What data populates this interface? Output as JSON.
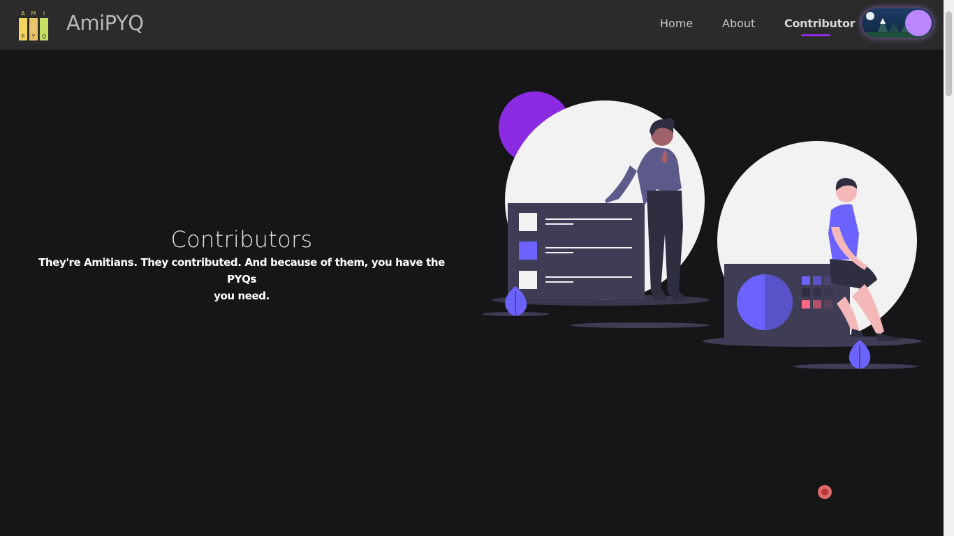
{
  "brand": {
    "name": "AmiPYQ",
    "logo_letters_top": [
      "A",
      "M",
      "I"
    ],
    "logo_letters_bottom": [
      "P",
      "Y",
      "Q"
    ]
  },
  "nav": {
    "items": [
      {
        "label": "Home",
        "active": false
      },
      {
        "label": "About",
        "active": false
      },
      {
        "label": "Contributor",
        "active": true
      }
    ],
    "theme_toggle_state": "dark"
  },
  "hero": {
    "title": "Contributors",
    "subtitle_line1": "They're Amitians. They contributed. And because of them, you have the PYQs",
    "subtitle_line2": "you need."
  },
  "colors": {
    "background": "#161618",
    "navbar": "#2b2b2b",
    "accent": "#8b2be2",
    "toggle_knob": "#bb86fc",
    "illustration_primary": "#6c63ff"
  }
}
